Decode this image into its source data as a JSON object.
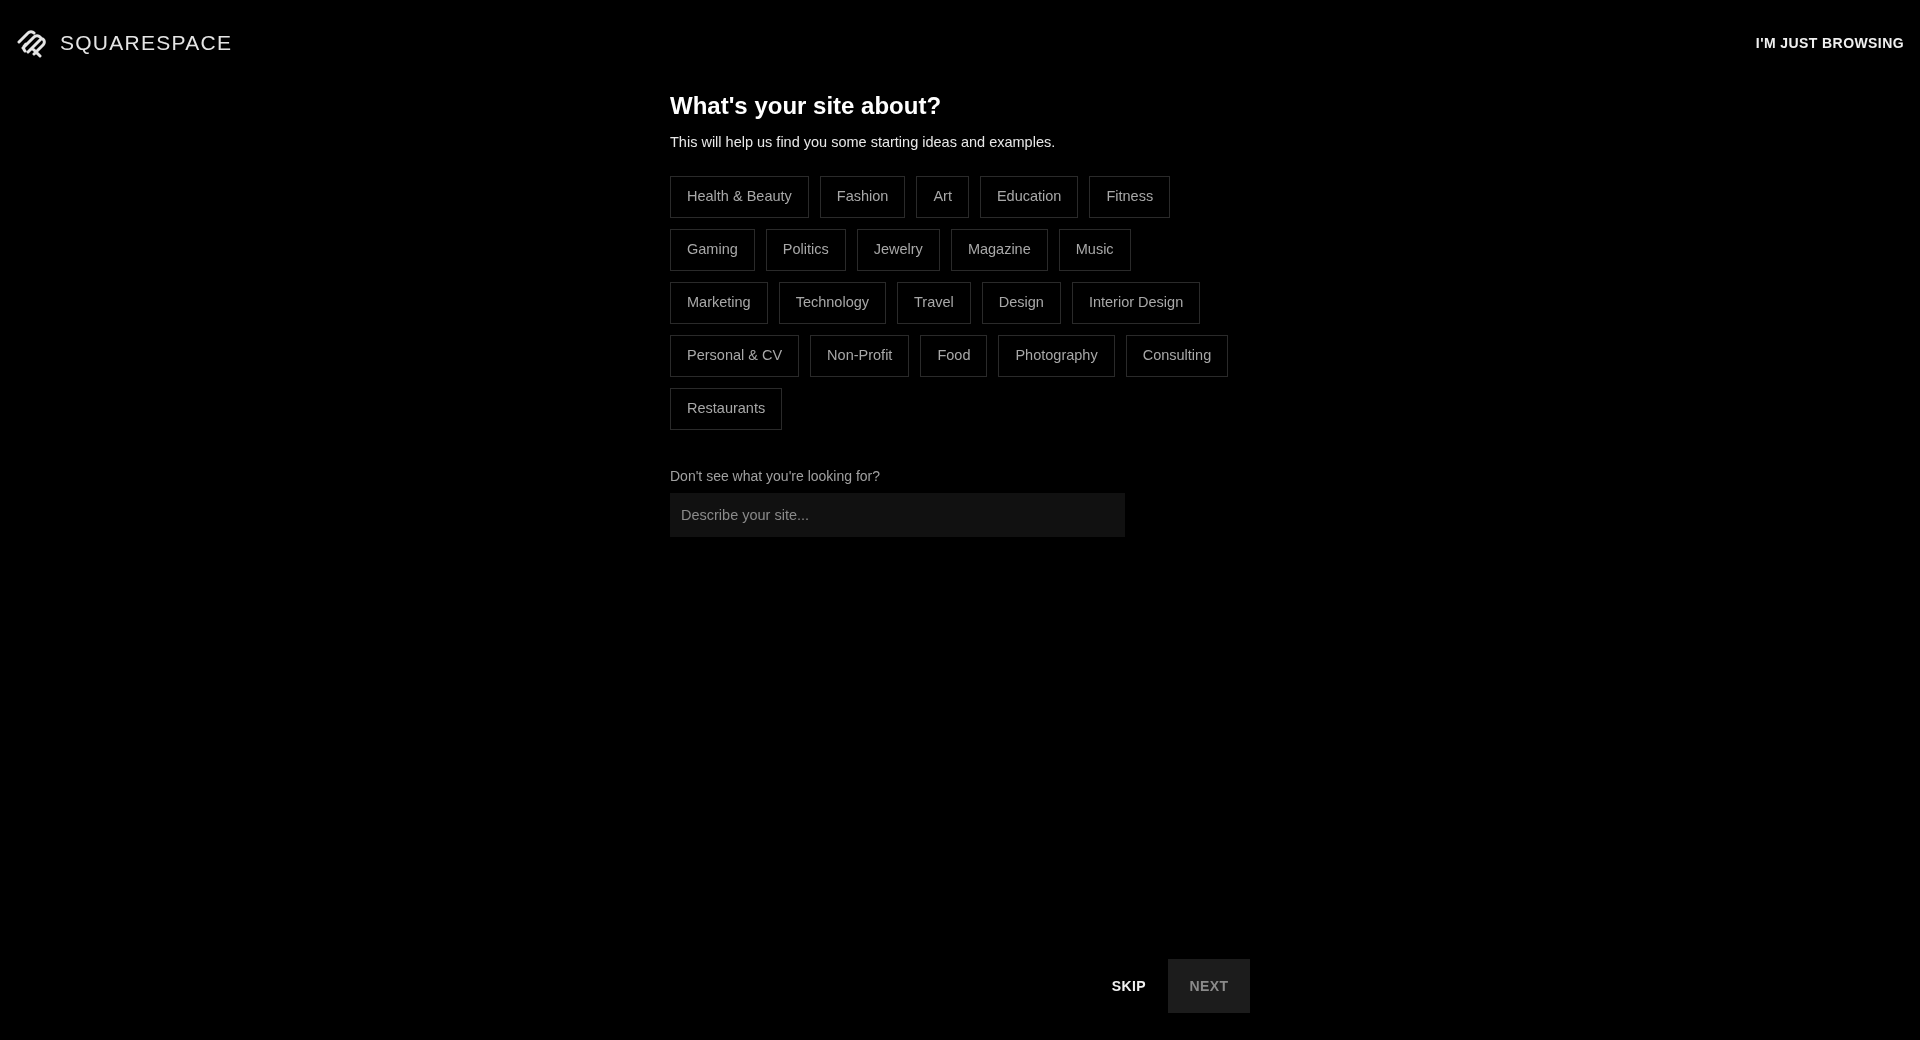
{
  "header": {
    "logo_text": "SQUARESPACE",
    "browse_link": "I'M JUST BROWSING"
  },
  "title": "What's your site about?",
  "subtitle": "This will help us find you some starting ideas and examples.",
  "categories": [
    {
      "label": "Health & Beauty",
      "selected": false
    },
    {
      "label": "Fashion",
      "selected": false
    },
    {
      "label": "Art",
      "selected": false
    },
    {
      "label": "Education",
      "selected": false
    },
    {
      "label": "Fitness",
      "selected": false
    },
    {
      "label": "Gaming",
      "selected": false
    },
    {
      "label": "Politics",
      "selected": false
    },
    {
      "label": "Jewelry",
      "selected": false
    },
    {
      "label": "Magazine",
      "selected": false
    },
    {
      "label": "Music",
      "selected": false
    },
    {
      "label": "Marketing",
      "selected": false
    },
    {
      "label": "Technology",
      "selected": false
    },
    {
      "label": "Travel",
      "selected": false
    },
    {
      "label": "Design",
      "selected": false
    },
    {
      "label": "Interior Design",
      "selected": false
    },
    {
      "label": "Personal & CV",
      "selected": false
    },
    {
      "label": "Non-Profit",
      "selected": false
    },
    {
      "label": "Food",
      "selected": false
    },
    {
      "label": "Photography",
      "selected": false
    },
    {
      "label": "Consulting",
      "selected": false
    },
    {
      "label": "Restaurants",
      "selected": false
    }
  ],
  "describe": {
    "label": "Don't see what you're looking for?",
    "placeholder": "Describe your site..."
  },
  "footer": {
    "skip": "SKIP",
    "next": {
      "label": "NEXT",
      "disabled": true
    }
  }
}
